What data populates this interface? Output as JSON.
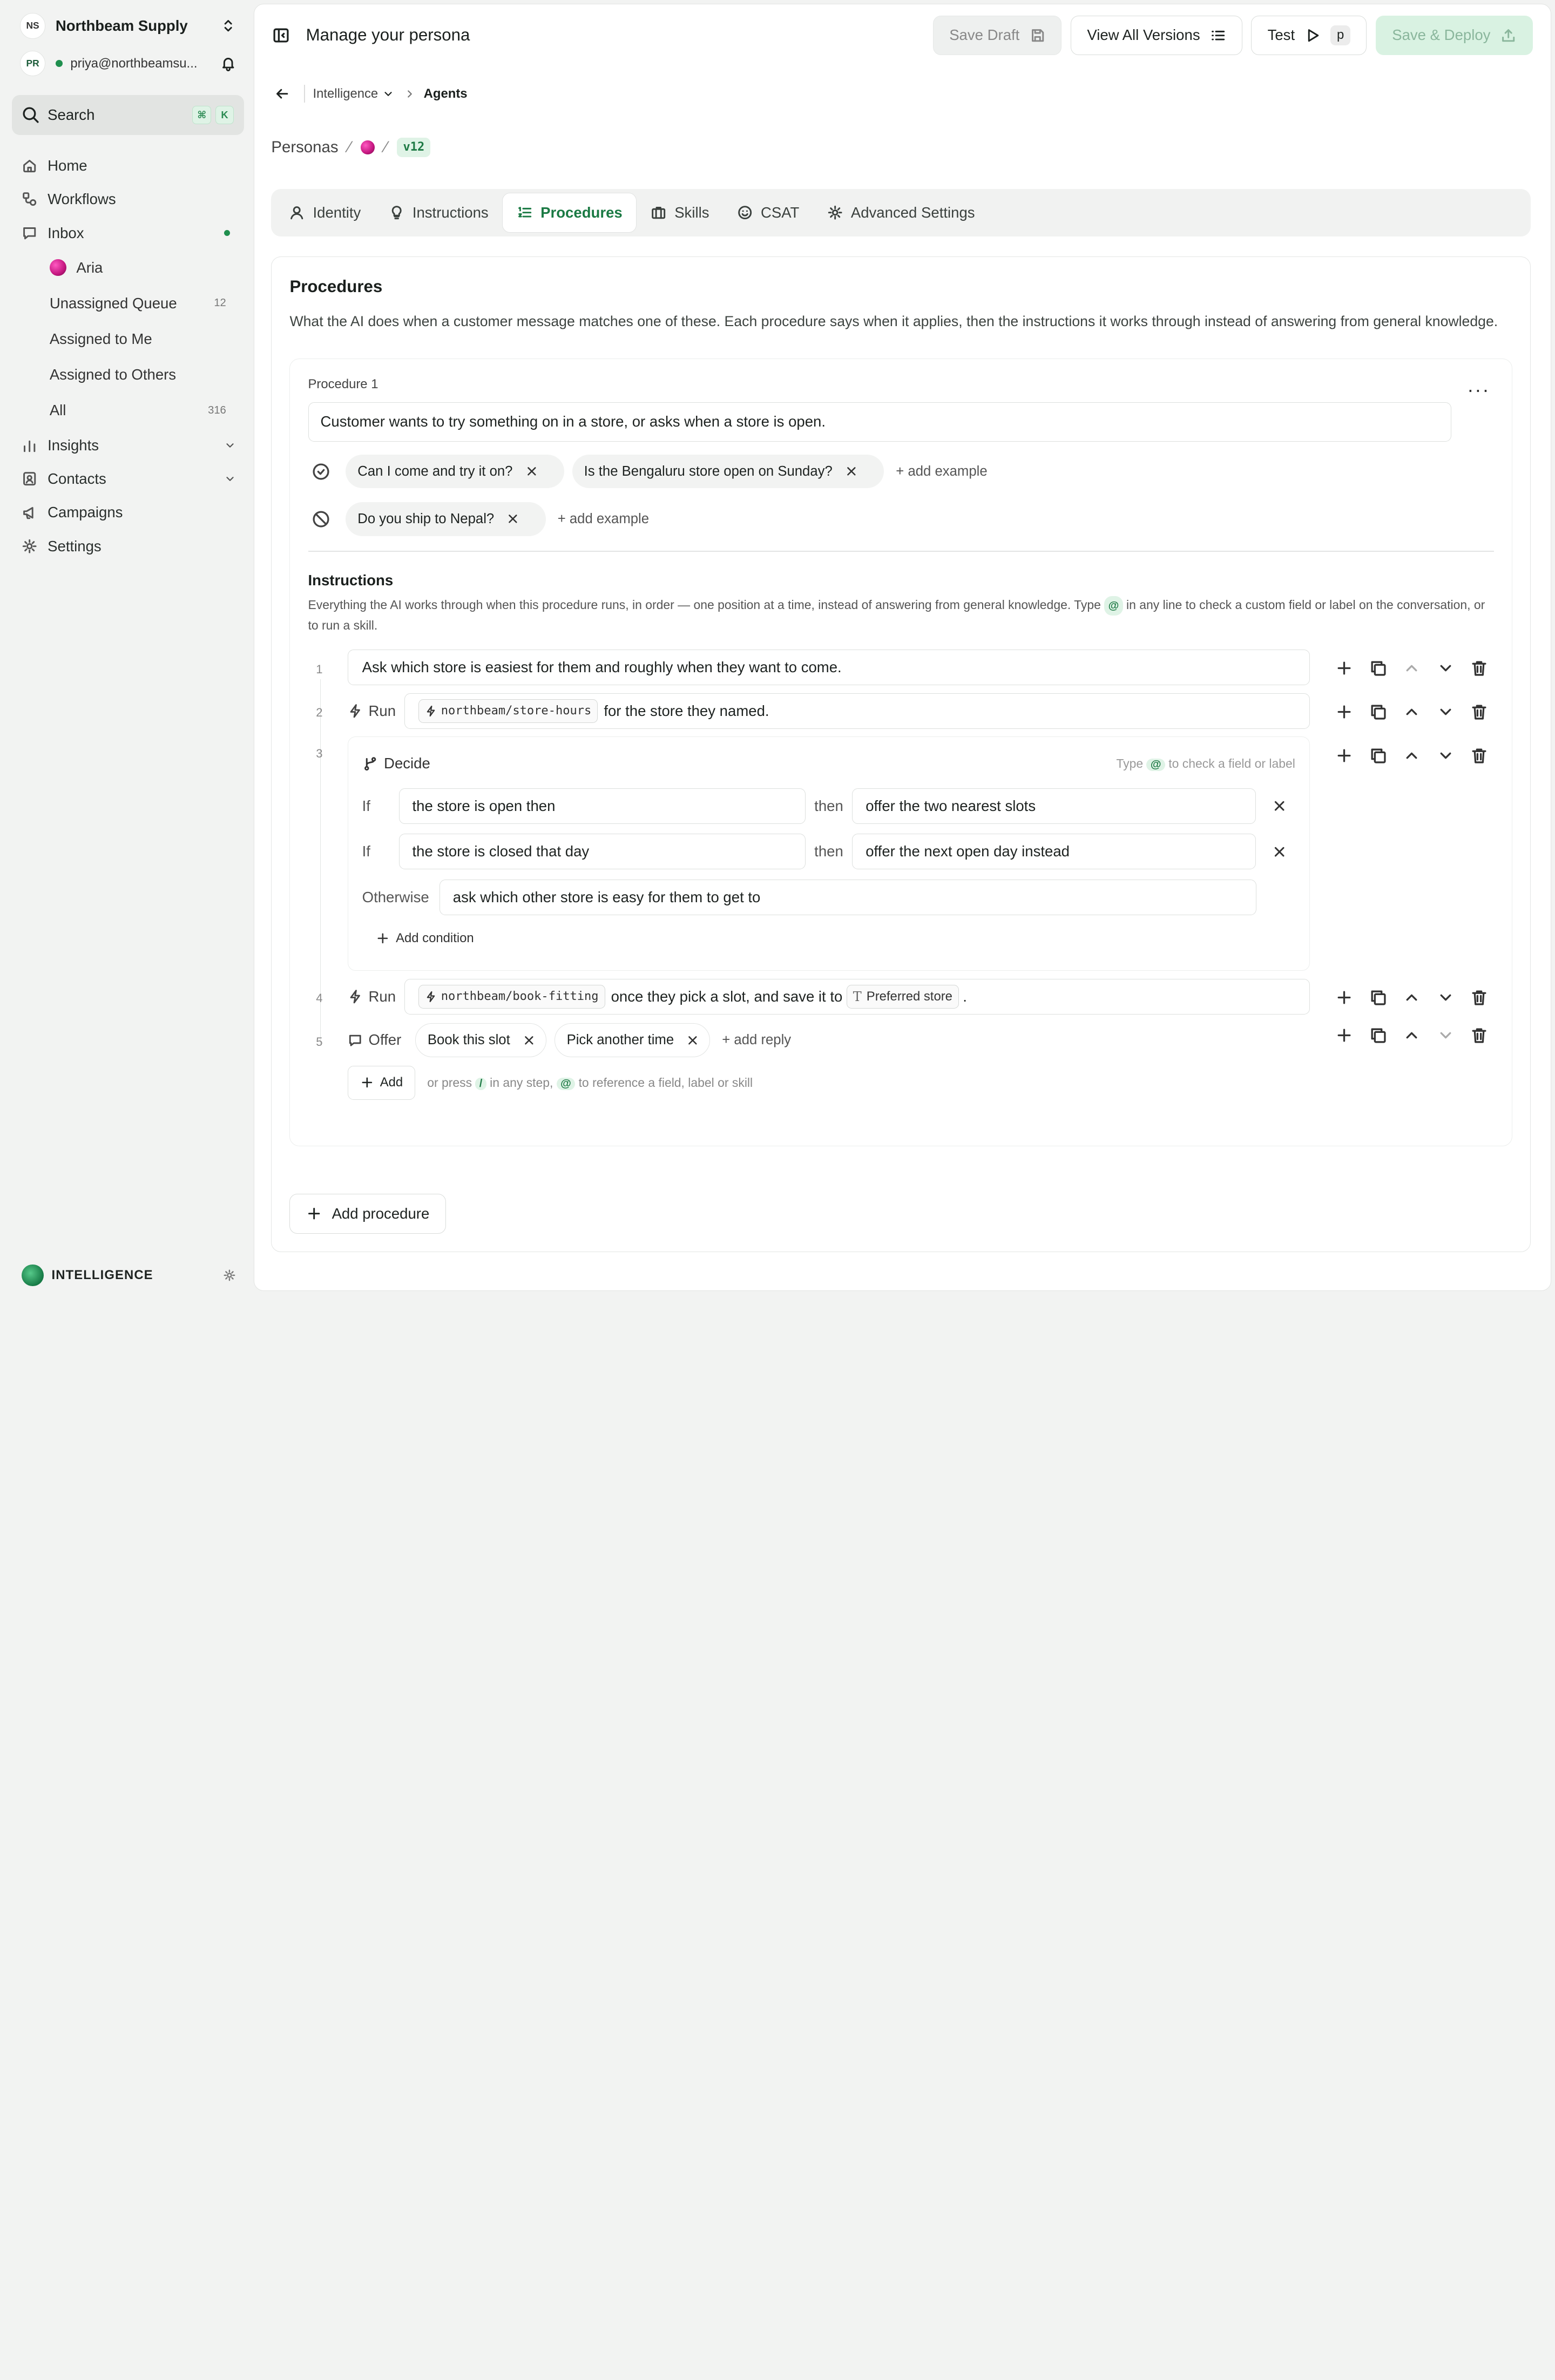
{
  "sidebar": {
    "org_initials": "NS",
    "org_name": "Northbeam Supply",
    "user_initials": "PR",
    "user_email": "priya@northbeamsu...",
    "search_label": "Search",
    "search_keys": [
      "⌘",
      "K"
    ],
    "nav": {
      "home": "Home",
      "workflows": "Workflows",
      "inbox": "Inbox",
      "insights": "Insights",
      "contacts": "Contacts",
      "campaigns": "Campaigns",
      "settings": "Settings"
    },
    "inbox_items": [
      {
        "label": "Aria",
        "count": ""
      },
      {
        "label": "Unassigned Queue",
        "count": "12"
      },
      {
        "label": "Assigned to Me",
        "count": ""
      },
      {
        "label": "Assigned to Others",
        "count": ""
      },
      {
        "label": "All",
        "count": "316"
      }
    ],
    "footer_brand": "INTELLIGENCE"
  },
  "topbar": {
    "title": "Manage your persona",
    "save_draft": "Save Draft",
    "view_versions": "View All Versions",
    "test": "Test",
    "test_key": "p",
    "save_deploy": "Save & Deploy"
  },
  "breadcrumb": {
    "section": "Intelligence",
    "page": "Agents"
  },
  "persona_path": {
    "root": "Personas",
    "version": "v12"
  },
  "tabs": [
    "Identity",
    "Instructions",
    "Procedures",
    "Skills",
    "CSAT",
    "Advanced Settings"
  ],
  "procedures": {
    "title": "Procedures",
    "description": "What the AI does when a customer message matches one of these. Each procedure says when it applies, then the instructions it works through instead of answering from general knowledge.",
    "procedure_label": "Procedure 1",
    "trigger": "Customer wants to try something on in a store, or asks when a store is open.",
    "positive_examples": [
      "Can I come and try it on?",
      "Is the Bengaluru store open on Sunday?"
    ],
    "negative_examples": [
      "Do you ship to Nepal?"
    ],
    "add_example": "+ add example",
    "instructions_title": "Instructions",
    "instructions_help_1": "Everything the AI works through when this procedure runs, in order — one position at a time, instead of answering from general knowledge. Type",
    "instructions_help_at": "@",
    "instructions_help_2": "in any line to check a custom field or label on the conversation, or to run a skill.",
    "steps": {
      "s1_num": "1",
      "s1_text": "Ask which store is easiest for them and roughly when they want to come.",
      "s2_num": "2",
      "s2_label": "Run",
      "s2_skill": "northbeam/store-hours",
      "s2_text": "for the store they named.",
      "s3_num": "3",
      "s3_label": "Decide",
      "s3_hint_1": "Type",
      "s3_hint_at": "@",
      "s3_hint_2": "to check a field or label",
      "if_kw": "If",
      "then_kw": "then",
      "otherwise_kw": "Otherwise",
      "conditions": [
        {
          "if": "the store is open then",
          "then": "offer the two nearest slots"
        },
        {
          "if": "the store is closed that day",
          "then": "offer the next open day instead"
        }
      ],
      "otherwise": "ask which other store is easy for them to get to",
      "add_condition": "Add condition",
      "s4_num": "4",
      "s4_label": "Run",
      "s4_skill": "northbeam/book-fitting",
      "s4_text": "once they pick a slot, and save it to",
      "s4_field": "Preferred store",
      "s4_end": ".",
      "s5_num": "5",
      "s5_label": "Offer",
      "s5_replies": [
        "Book this slot",
        "Pick another time"
      ],
      "s5_add": "+ add reply"
    },
    "add_button": "Add",
    "add_hint_1": "or press",
    "add_hint_slash": "/",
    "add_hint_2": "in any step,",
    "add_hint_at": "@",
    "add_hint_3": "to reference a field, label or skill",
    "add_procedure": "Add procedure"
  },
  "colors": {
    "accent": "#1b7a44",
    "accent_soft": "#dff3e6",
    "online": "#1f8f4e"
  }
}
